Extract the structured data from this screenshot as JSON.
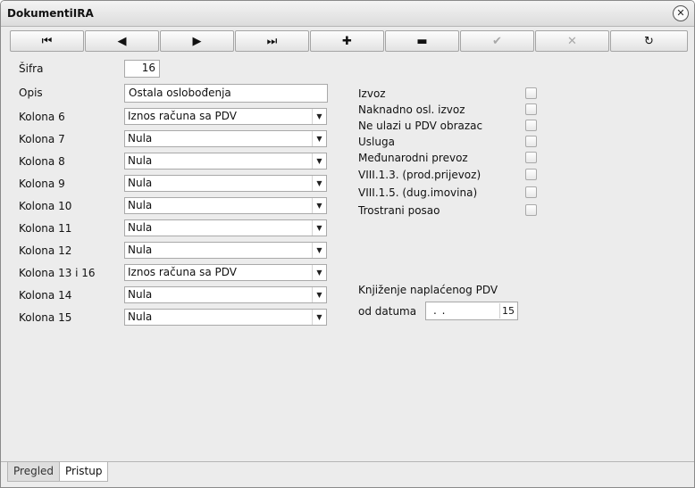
{
  "window": {
    "title": "DokumentiIRA",
    "close_icon": "✕"
  },
  "toolbar": [
    {
      "name": "first-record-button",
      "icon": "⏮",
      "enabled": true
    },
    {
      "name": "previous-record-button",
      "icon": "◀",
      "enabled": true
    },
    {
      "name": "next-record-button",
      "icon": "▶",
      "enabled": true
    },
    {
      "name": "last-record-button",
      "icon": "⏭",
      "enabled": true
    },
    {
      "name": "add-record-button",
      "icon": "✚",
      "enabled": true
    },
    {
      "name": "delete-record-button",
      "icon": "▬",
      "enabled": true
    },
    {
      "name": "confirm-button",
      "icon": "✔",
      "enabled": false
    },
    {
      "name": "cancel-button",
      "icon": "✕",
      "enabled": false
    },
    {
      "name": "refresh-button",
      "icon": "↻",
      "enabled": true
    }
  ],
  "form": {
    "sifra_label": "Šifra",
    "sifra_value": "16",
    "opis_label": "Opis",
    "opis_value": "Ostala oslobođenja",
    "columns": [
      {
        "label": "Kolona 6",
        "value": "Iznos računa sa PDV"
      },
      {
        "label": "Kolona 7",
        "value": "Nula"
      },
      {
        "label": "Kolona 8",
        "value": "Nula"
      },
      {
        "label": "Kolona 9",
        "value": "Nula"
      },
      {
        "label": "Kolona 10",
        "value": "Nula"
      },
      {
        "label": "Kolona 11",
        "value": "Nula"
      },
      {
        "label": "Kolona 12",
        "value": "Nula"
      },
      {
        "label": "Kolona 13 i 16",
        "value": "Iznos računa sa PDV"
      },
      {
        "label": "Kolona 14",
        "value": "Nula"
      },
      {
        "label": "Kolona 15",
        "value": "Nula"
      }
    ],
    "checkboxes": [
      {
        "label": "Izvoz",
        "checked": false
      },
      {
        "label": "Naknadno osl. izvoz",
        "checked": false
      },
      {
        "label": "Ne ulazi u PDV obrazac",
        "checked": false
      },
      {
        "label": "Usluga",
        "checked": false
      },
      {
        "label": "Međunarodni prevoz",
        "checked": false
      },
      {
        "label": "VIII.1.3. (prod.prijevoz)",
        "checked": false
      },
      {
        "label": "VIII.1.5. (dug.imovina)",
        "checked": false
      },
      {
        "label": "Trostrani posao",
        "checked": false
      }
    ],
    "knjizenje_label": "Knjiženje naplaćenog PDV",
    "od_datuma_label": "od datuma",
    "od_datuma_value": ". .",
    "calendar_icon": "15"
  },
  "tabs": [
    {
      "label": "Pregled",
      "active": false
    },
    {
      "label": "Pristup",
      "active": true
    }
  ]
}
